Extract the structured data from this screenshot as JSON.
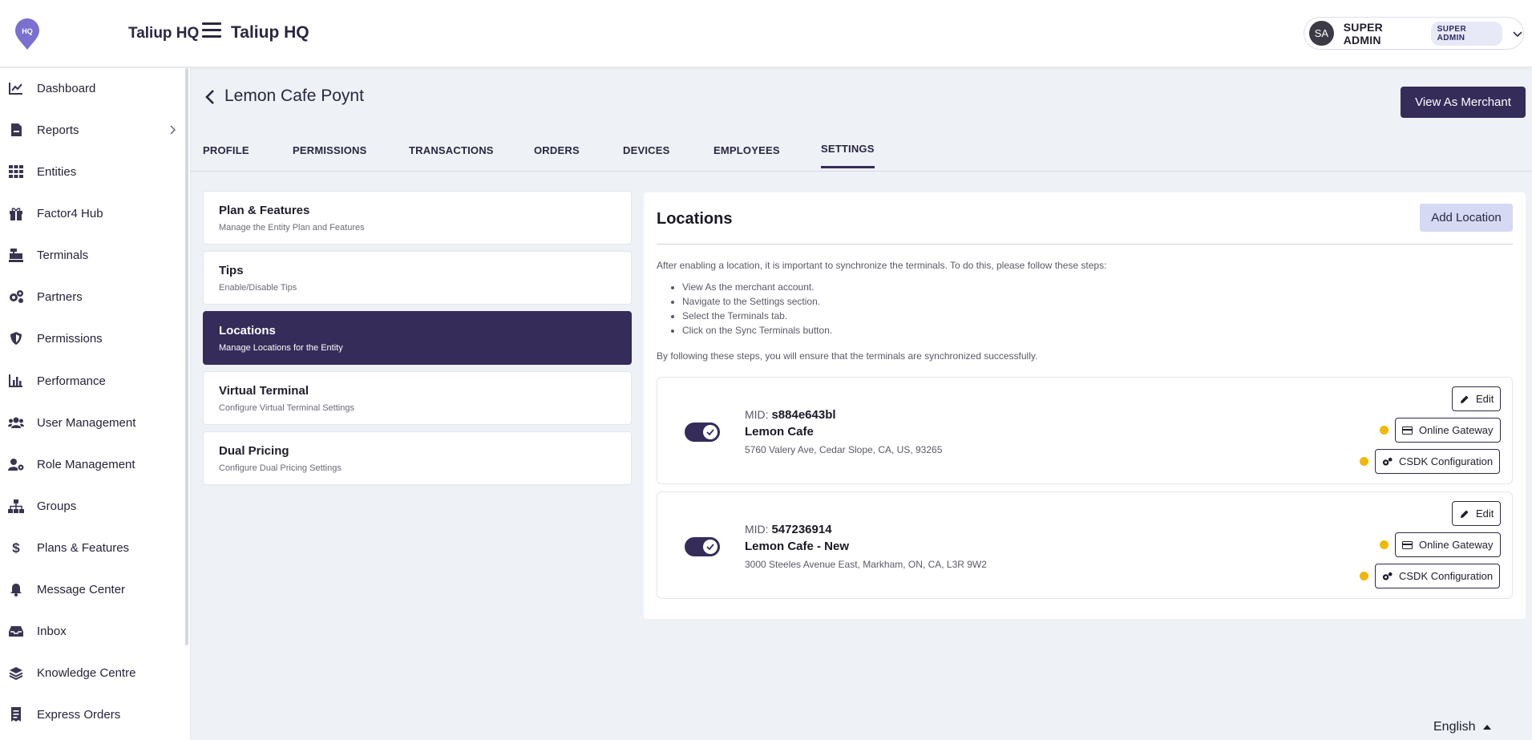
{
  "header": {
    "logo_text": "HQ",
    "brand": "Taliup HQ",
    "app_title": "Taliup HQ",
    "user": {
      "initials": "SA",
      "name": "SUPER ADMIN",
      "role_badge": "SUPER ADMIN"
    }
  },
  "sidebar": {
    "items": [
      {
        "label": "Dashboard",
        "icon": "chart-line-icon"
      },
      {
        "label": "Reports",
        "icon": "report-file-icon",
        "has_submenu": true
      },
      {
        "label": "Entities",
        "icon": "grid-icon"
      },
      {
        "label": "Factor4 Hub",
        "icon": "gift-icon"
      },
      {
        "label": "Terminals",
        "icon": "cash-register-icon"
      },
      {
        "label": "Partners",
        "icon": "cogs-icon"
      },
      {
        "label": "Permissions",
        "icon": "shield-icon"
      },
      {
        "label": "Performance",
        "icon": "bar-chart-icon"
      },
      {
        "label": "User Management",
        "icon": "users-icon"
      },
      {
        "label": "Role Management",
        "icon": "user-cog-icon"
      },
      {
        "label": "Groups",
        "icon": "sitemap-icon"
      },
      {
        "label": "Plans & Features",
        "icon": "dollar-icon"
      },
      {
        "label": "Message Center",
        "icon": "bell-icon"
      },
      {
        "label": "Inbox",
        "icon": "inbox-icon"
      },
      {
        "label": "Knowledge Centre",
        "icon": "layers-icon"
      },
      {
        "label": "Express Orders",
        "icon": "receipt-icon"
      }
    ]
  },
  "page": {
    "entity_title": "Lemon Cafe Poynt",
    "view_as_merchant": "View As Merchant",
    "tabs": [
      "PROFILE",
      "PERMISSIONS",
      "TRANSACTIONS",
      "ORDERS",
      "DEVICES",
      "EMPLOYEES",
      "SETTINGS"
    ],
    "active_tab": "SETTINGS"
  },
  "settings_menu": [
    {
      "title": "Plan & Features",
      "subtitle": "Manage the Entity Plan and Features"
    },
    {
      "title": "Tips",
      "subtitle": "Enable/Disable Tips"
    },
    {
      "title": "Locations",
      "subtitle": "Manage Locations for the Entity",
      "active": true
    },
    {
      "title": "Virtual Terminal",
      "subtitle": "Configure Virtual Terminal Settings"
    },
    {
      "title": "Dual Pricing",
      "subtitle": "Configure Dual Pricing Settings"
    }
  ],
  "locations": {
    "title": "Locations",
    "add_button": "Add Location",
    "intro": "After enabling a location, it is important to synchronize the terminals. To do this, please follow these steps:",
    "steps": [
      "View As the merchant account.",
      "Navigate to the Settings section.",
      "Select the Terminals tab.",
      "Click on the Sync Terminals button."
    ],
    "outro": "By following these steps, you will ensure that the terminals are synchronized successfully.",
    "mid_label": "MID:",
    "edit_label": "Edit",
    "gateway_label": "Online Gateway",
    "csdk_label": "CSDK Configuration",
    "items": [
      {
        "mid": "s884e643bl",
        "name": "Lemon Cafe",
        "address": "5760 Valery Ave, Cedar Slope, CA, US, 93265",
        "enabled": true
      },
      {
        "mid": "547236914",
        "name": "Lemon Cafe - New",
        "address": "3000 Steeles Avenue East, Markham, ON, CA, L3R 9W2",
        "enabled": true
      }
    ]
  },
  "footer": {
    "language": "English"
  },
  "colors": {
    "primary": "#352c59",
    "accent_light": "#d6d9f3",
    "warning": "#f2b705",
    "background": "#eef1f6"
  }
}
